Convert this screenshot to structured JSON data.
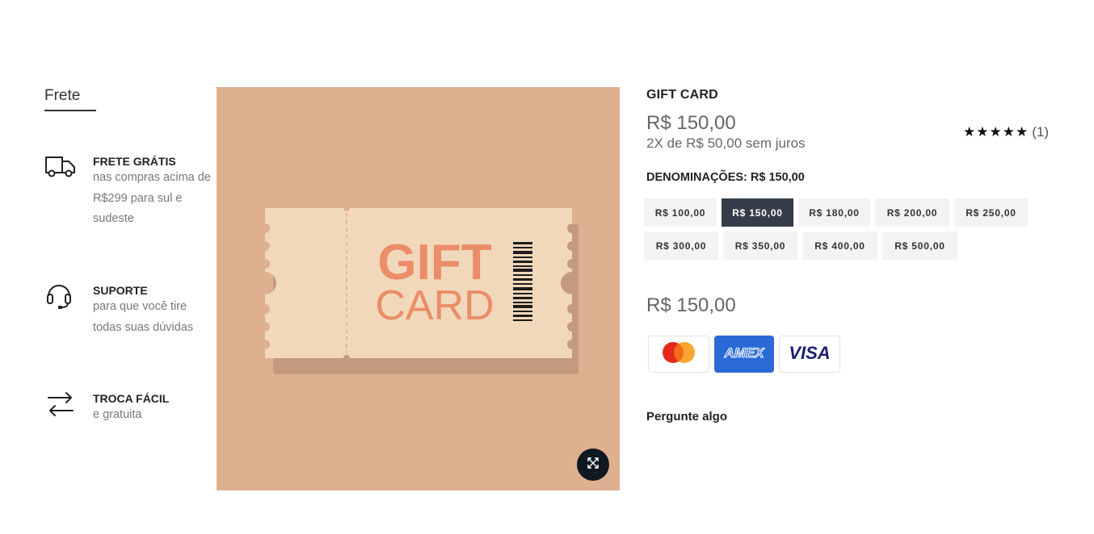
{
  "sidebar": {
    "title": "Frete",
    "features": [
      {
        "icon": "truck-icon",
        "title": "FRETE GRÁTIS",
        "text": "nas compras acima de R$299 para sul e sudeste"
      },
      {
        "icon": "headset-icon",
        "title": "SUPORTE",
        "text": "para que você tire todas suas dúvidas"
      },
      {
        "icon": "swap-arrows-icon",
        "title": "TROCA FÁCIL",
        "text": "e gratuita"
      }
    ]
  },
  "image": {
    "card_word1": "GIFT",
    "card_word2": "CARD",
    "colors": {
      "background": "#dfb090",
      "ticket": "#f2d8bb",
      "text": "#ea8d68"
    },
    "zoom_icon": "expand-icon"
  },
  "product": {
    "title": "GIFT CARD",
    "price": "R$ 150,00",
    "installments": "2X de R$ 50,00 sem juros",
    "rating": {
      "stars": "★★★★★",
      "value": 5,
      "max": 5,
      "count": "(1)"
    },
    "denominations_label": "DENOMINAÇÕES:",
    "selected_denomination": "R$ 150,00",
    "options": [
      "R$ 100,00",
      "R$ 150,00",
      "R$ 180,00",
      "R$ 200,00",
      "R$ 250,00",
      "R$ 300,00",
      "R$ 350,00",
      "R$ 400,00",
      "R$ 500,00"
    ],
    "total_price": "R$ 150,00",
    "payment_methods": [
      {
        "name": "mastercard",
        "icon": "mastercard-icon"
      },
      {
        "name": "AMEX",
        "icon": "amex-icon"
      },
      {
        "name": "VISA",
        "icon": "visa-icon"
      }
    ],
    "ask_label": "Pergunte algo"
  },
  "colors": {
    "selected_option": "#353d4a",
    "option_bg": "#f3f3f3",
    "amex_blue": "#2a6ad6",
    "visa_blue": "#1a1f71"
  }
}
